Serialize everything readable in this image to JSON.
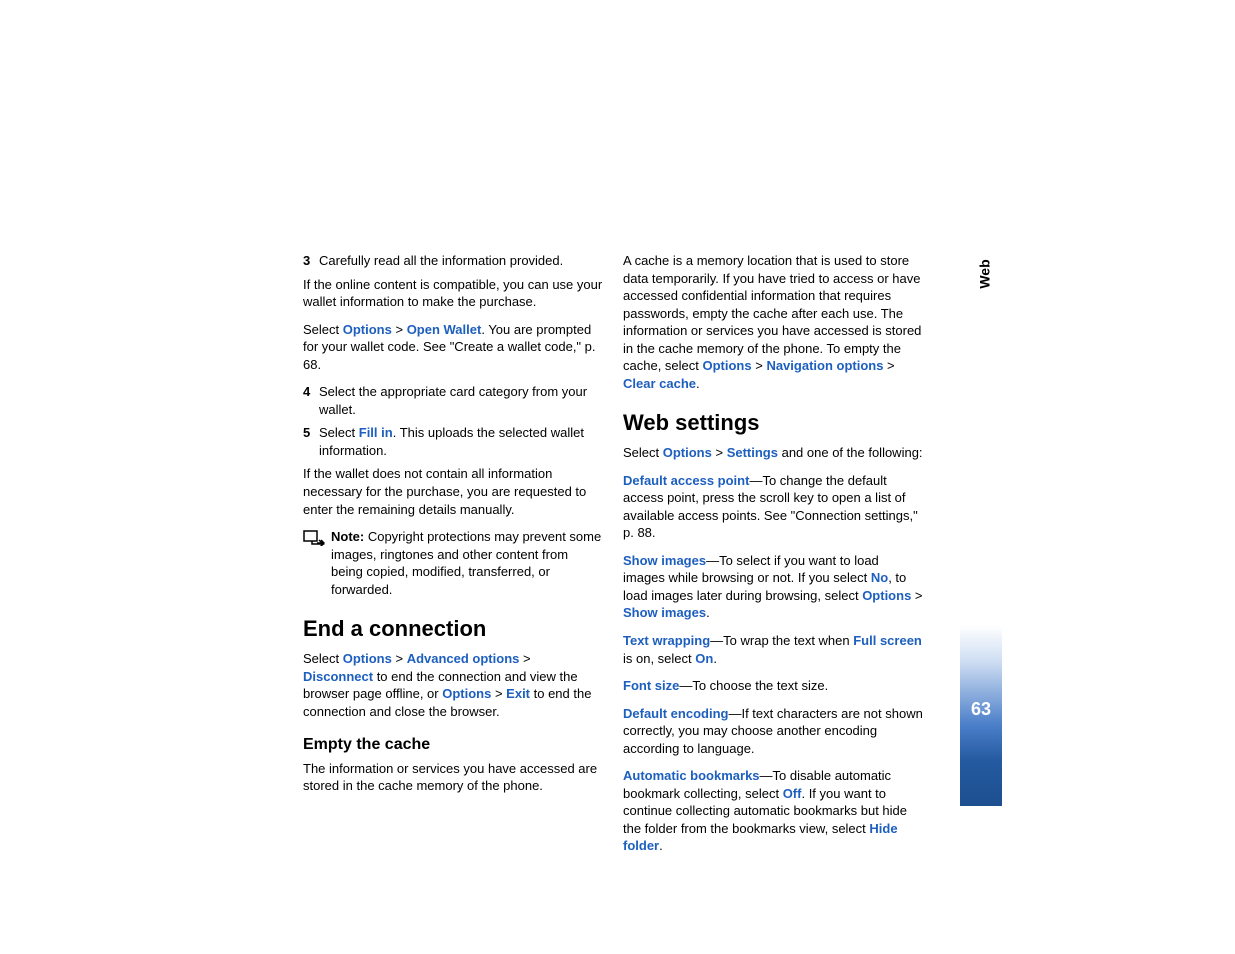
{
  "sidebar": {
    "label": "Web",
    "page_number": "63"
  },
  "left": {
    "item3_num": "3",
    "item3_text": "Carefully read all the information provided.",
    "item3_sub": "If the online content is compatible, you can use your wallet information to make the purchase.",
    "p1_a": "Select ",
    "p1_options": "Options",
    "p1_gt1": " > ",
    "p1_openwallet": "Open Wallet",
    "p1_b": ". You are prompted for your wallet code. See \"Create a wallet code,\" p. 68.",
    "item4_num": "4",
    "item4_text": "Select the appropriate card category from your wallet.",
    "item5_num": "5",
    "item5_a": "Select ",
    "item5_fillin": "Fill in",
    "item5_b": ". This uploads the selected wallet information.",
    "item5_sub": "If the wallet does not contain all information necessary for the purchase, you are requested to enter the remaining details manually.",
    "note_label": "Note:",
    "note_text": " Copyright protections may prevent some images, ringtones and other content from being copied, modified, transferred, or forwarded.",
    "h2_end": "End a connection",
    "end_a": "Select ",
    "end_options": "Options",
    "end_gt1": " > ",
    "end_adv": "Advanced options",
    "end_gt2": " > ",
    "end_disc": "Disconnect",
    "end_b": " to end the connection and view the browser page offline, or ",
    "end_options2": "Options",
    "end_gt3": " > ",
    "end_exit": "Exit",
    "end_c": " to end the connection and close the browser.",
    "h3_cache": "Empty the cache",
    "cache_p": "The information or services you have accessed are stored in the cache memory of the phone."
  },
  "right": {
    "cache2_a": "A cache is a memory location that is used to store data temporarily. If you have tried to access or have accessed confidential information that requires passwords, empty the cache after each use. The information or services you have accessed is stored in the cache memory of the phone. To empty the cache, select ",
    "cache2_options": "Options",
    "cache2_gt1": " > ",
    "cache2_nav": "Navigation options",
    "cache2_gt2": " > ",
    "cache2_clear": "Clear cache",
    "cache2_b": ".",
    "h2_settings": "Web settings",
    "set_a": "Select ",
    "set_options": "Options",
    "set_gt1": " > ",
    "set_settings": "Settings",
    "set_b": " and one of the following:",
    "dap_label": "Default access point",
    "dap_text": "—To change the default access point, press the scroll key to open a list of available access points. See \"Connection settings,\" p. 88.",
    "si_label": "Show images",
    "si_a": "—To select if you want to load images while browsing or not. If you select ",
    "si_no": "No",
    "si_b": ", to load images later during browsing, select ",
    "si_options": "Options",
    "si_gt": " > ",
    "si_show": "Show images",
    "si_c": ".",
    "tw_label": "Text wrapping",
    "tw_a": "—To wrap the text when ",
    "tw_full": "Full screen",
    "tw_b": " is on, select ",
    "tw_on": "On",
    "tw_c": ".",
    "fs_label": "Font size",
    "fs_text": "—To choose the text size.",
    "de_label": "Default encoding",
    "de_text": "—If text characters are not shown correctly, you may choose another encoding according to language.",
    "ab_label": "Automatic bookmarks",
    "ab_a": "—To disable automatic bookmark collecting, select ",
    "ab_off": "Off",
    "ab_b": ". If you want to continue collecting automatic bookmarks but hide the folder from the bookmarks view, select ",
    "ab_hide": "Hide folder",
    "ab_c": "."
  }
}
